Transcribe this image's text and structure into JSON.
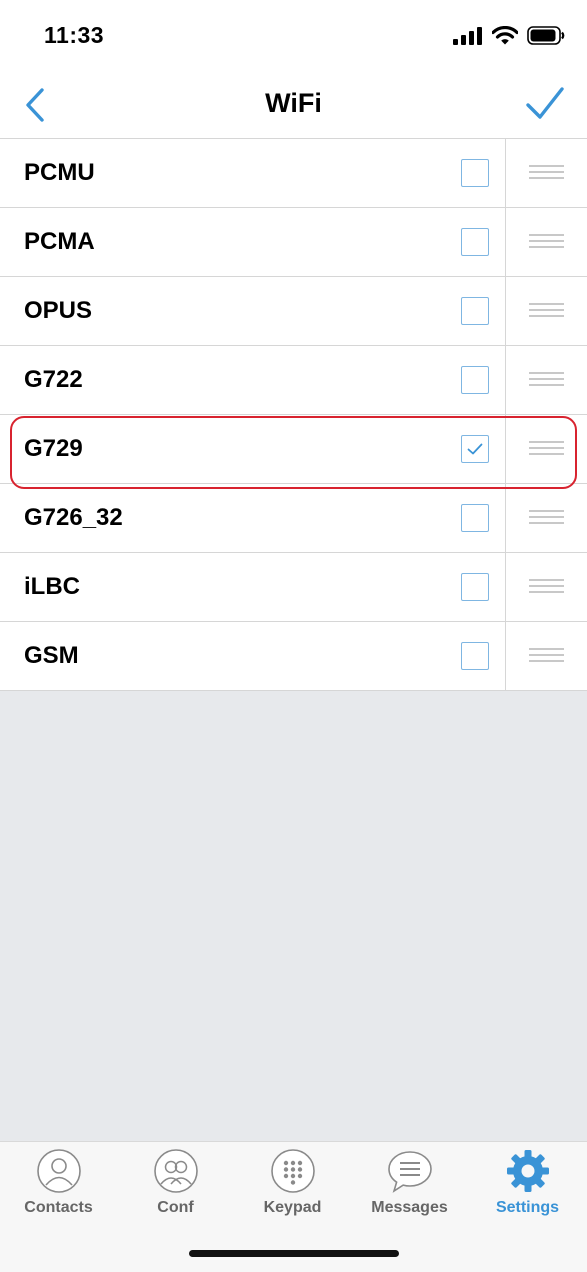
{
  "status": {
    "time": "11:33"
  },
  "nav": {
    "title": "WiFi"
  },
  "codecs": [
    {
      "name": "PCMU",
      "checked": false
    },
    {
      "name": "PCMA",
      "checked": false
    },
    {
      "name": "OPUS",
      "checked": false
    },
    {
      "name": "G722",
      "checked": false
    },
    {
      "name": "G729",
      "checked": true
    },
    {
      "name": "G726_32",
      "checked": false
    },
    {
      "name": "iLBC",
      "checked": false
    },
    {
      "name": "GSM",
      "checked": false
    }
  ],
  "tabs": [
    {
      "label": "Contacts",
      "icon": "contacts-icon",
      "active": false
    },
    {
      "label": "Conf",
      "icon": "conference-icon",
      "active": false
    },
    {
      "label": "Keypad",
      "icon": "keypad-icon",
      "active": false
    },
    {
      "label": "Messages",
      "icon": "messages-icon",
      "active": false
    },
    {
      "label": "Settings",
      "icon": "gear-icon",
      "active": true
    }
  ],
  "colors": {
    "accent": "#3a93d6",
    "highlight": "#d8232f",
    "background": "#e7e9ec"
  }
}
